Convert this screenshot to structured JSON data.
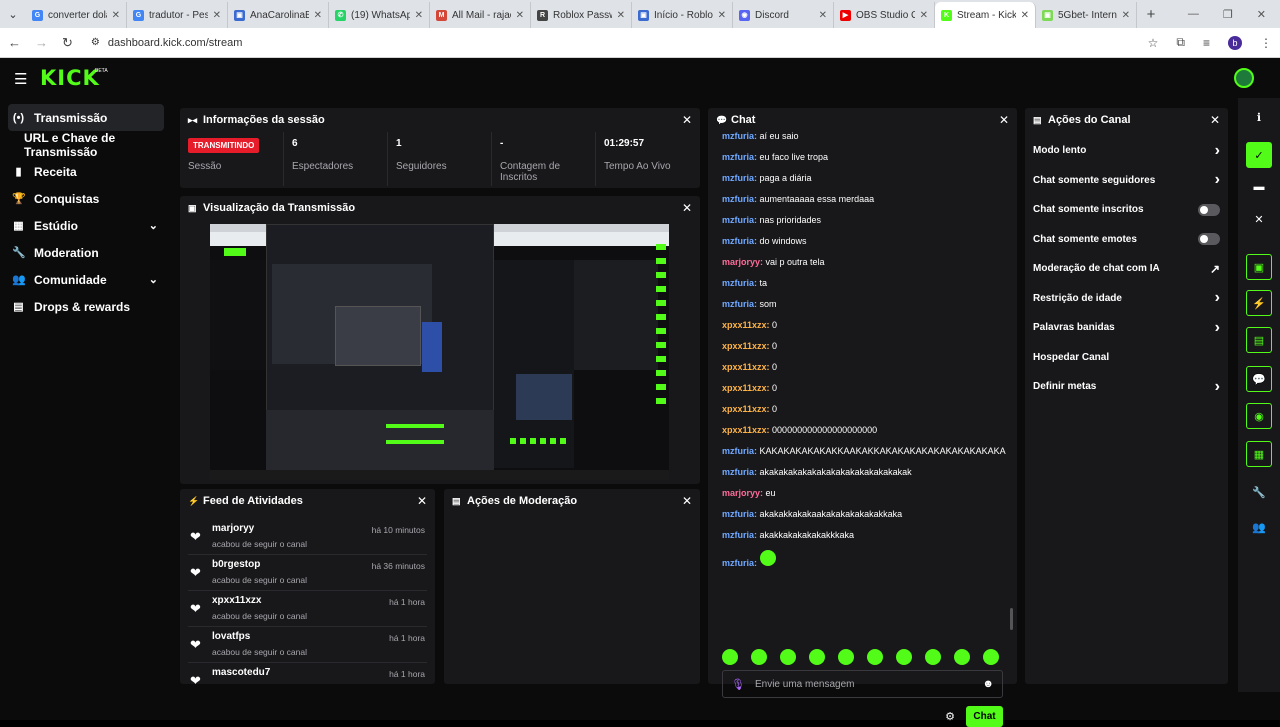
{
  "browser": {
    "tabs": [
      {
        "label": "converter dola",
        "fav": "G",
        "color": "#4285f4"
      },
      {
        "label": "tradutor - Pesq",
        "fav": "G",
        "color": "#4285f4"
      },
      {
        "label": "AnaCarolinaBu",
        "fav": "▣",
        "color": "#3b6ad1"
      },
      {
        "label": "(19) WhatsApp",
        "fav": "✆",
        "color": "#25d366"
      },
      {
        "label": "All Mail - rajao",
        "fav": "M",
        "color": "#d44638"
      },
      {
        "label": "Roblox Passwo",
        "fav": "R",
        "color": "#444"
      },
      {
        "label": "Início - Roblox",
        "fav": "▣",
        "color": "#3b6ad1"
      },
      {
        "label": "Discord",
        "fav": "◉",
        "color": "#5865f2"
      },
      {
        "label": "OBS Studio CO",
        "fav": "▶",
        "color": "#e00"
      },
      {
        "label": "Stream - Kick D",
        "fav": "K",
        "color": "#53fc18",
        "active": true
      },
      {
        "label": "5Gbet- Interne",
        "fav": "▣",
        "color": "#7ed957"
      }
    ],
    "url": "dashboard.kick.com/stream"
  },
  "app": {
    "logo": "KICK",
    "beta": "BETA"
  },
  "sidebar": {
    "items": [
      {
        "label": "Transmissão",
        "icon": "broadcast-icon",
        "glyph": "(•)",
        "active": true
      },
      {
        "label": "URL e Chave de Transmissão",
        "sub": true
      },
      {
        "label": "Receita",
        "icon": "chart-icon",
        "glyph": "▮"
      },
      {
        "label": "Conquistas",
        "icon": "trophy-icon",
        "glyph": "🏆"
      },
      {
        "label": "Estúdio",
        "icon": "studio-icon",
        "glyph": "▦",
        "chevron": true
      },
      {
        "label": "Moderation",
        "icon": "wrench-icon",
        "glyph": "🔧"
      },
      {
        "label": "Comunidade",
        "icon": "community-icon",
        "glyph": "👥",
        "chevron": true
      },
      {
        "label": "Drops & rewards",
        "icon": "drops-icon",
        "glyph": "▤"
      }
    ]
  },
  "session": {
    "title": "Informações da sessão",
    "status_badge": "TRANSMITINDO",
    "stats": [
      {
        "value": "",
        "label": "Sessão"
      },
      {
        "value": "6",
        "label": "Espectadores"
      },
      {
        "value": "1",
        "label": "Seguidores"
      },
      {
        "value": "-",
        "label": "Contagem de Inscritos"
      },
      {
        "value": "01:29:57",
        "label": "Tempo Ao Vivo"
      }
    ]
  },
  "preview": {
    "title": "Visualização da Transmissão"
  },
  "activity": {
    "title": "Feed de Atividades",
    "items": [
      {
        "name": "marjoryy",
        "desc": "acabou de seguir o canal",
        "time": "há 10 minutos"
      },
      {
        "name": "b0rgestop",
        "desc": "acabou de seguir o canal",
        "time": "há 36 minutos"
      },
      {
        "name": "xpxx11xzx",
        "desc": "acabou de seguir o canal",
        "time": "há 1 hora"
      },
      {
        "name": "lovatfps",
        "desc": "acabou de seguir o canal",
        "time": "há 1 hora"
      },
      {
        "name": "mascotedu7",
        "desc": "",
        "time": "há 1 hora"
      }
    ]
  },
  "moderation_actions": {
    "title": "Ações de Moderação"
  },
  "chat": {
    "title": "Chat",
    "messages": [
      {
        "user": "mzfuria",
        "text": "aí eu saio",
        "color": "#6fa8ff"
      },
      {
        "user": "mzfuria",
        "text": "eu faco live tropa",
        "color": "#6fa8ff"
      },
      {
        "user": "mzfuria",
        "text": "paga a diária",
        "color": "#6fa8ff"
      },
      {
        "user": "mzfuria",
        "text": "aumentaaaaa essa merdaaa",
        "color": "#6fa8ff"
      },
      {
        "user": "mzfuria",
        "text": "nas prioridades",
        "color": "#6fa8ff"
      },
      {
        "user": "mzfuria",
        "text": "do windows",
        "color": "#6fa8ff"
      },
      {
        "user": "marjoryy",
        "text": "vai p outra tela",
        "color": "#ff6b9a"
      },
      {
        "user": "mzfuria",
        "text": "ta",
        "color": "#6fa8ff"
      },
      {
        "user": "mzfuria",
        "text": "som",
        "color": "#6fa8ff"
      },
      {
        "user": "xpxx11xzx",
        "text": "0",
        "color": "#ffb347"
      },
      {
        "user": "xpxx11xzx",
        "text": "0",
        "color": "#ffb347"
      },
      {
        "user": "xpxx11xzx",
        "text": "0",
        "color": "#ffb347"
      },
      {
        "user": "xpxx11xzx",
        "text": "0",
        "color": "#ffb347"
      },
      {
        "user": "xpxx11xzx",
        "text": "0",
        "color": "#ffb347"
      },
      {
        "user": "xpxx11xzx",
        "text": "000000000000000000000",
        "color": "#ffb347"
      },
      {
        "user": "mzfuria",
        "text": "KAKAKAKAKAKAKKAAKAKKAKAKAKAKAKAKAKAKAKAKA",
        "color": "#6fa8ff"
      },
      {
        "user": "mzfuria",
        "text": "akakakakakakakakakakakakakakakak",
        "color": "#6fa8ff"
      },
      {
        "user": "marjoryy",
        "text": "eu",
        "color": "#ff6b9a"
      },
      {
        "user": "mzfuria",
        "text": "akakakkakakaakakakakakakakkaka",
        "color": "#6fa8ff"
      },
      {
        "user": "mzfuria",
        "text": "akakkakakakakakkkaka",
        "color": "#6fa8ff"
      },
      {
        "user": "mzfuria",
        "text": "",
        "color": "#6fa8ff"
      }
    ],
    "input_placeholder": "Envie uma mensagem",
    "send_label": "Chat"
  },
  "channel_actions": {
    "title": "Ações do Canal",
    "items": [
      {
        "label": "Modo lento",
        "control": "chevron"
      },
      {
        "label": "Chat somente seguidores",
        "control": "chevron"
      },
      {
        "label": "Chat somente inscritos",
        "control": "toggle"
      },
      {
        "label": "Chat somente emotes",
        "control": "toggle"
      },
      {
        "label": "Moderação de chat com IA",
        "control": "external"
      },
      {
        "label": "Restrição de idade",
        "control": "chevron"
      },
      {
        "label": "Palavras banidas",
        "control": "chevron"
      },
      {
        "label": "Hospedar Canal",
        "control": "none"
      },
      {
        "label": "Definir metas",
        "control": "chevron"
      }
    ]
  },
  "accent": "#53fc18"
}
